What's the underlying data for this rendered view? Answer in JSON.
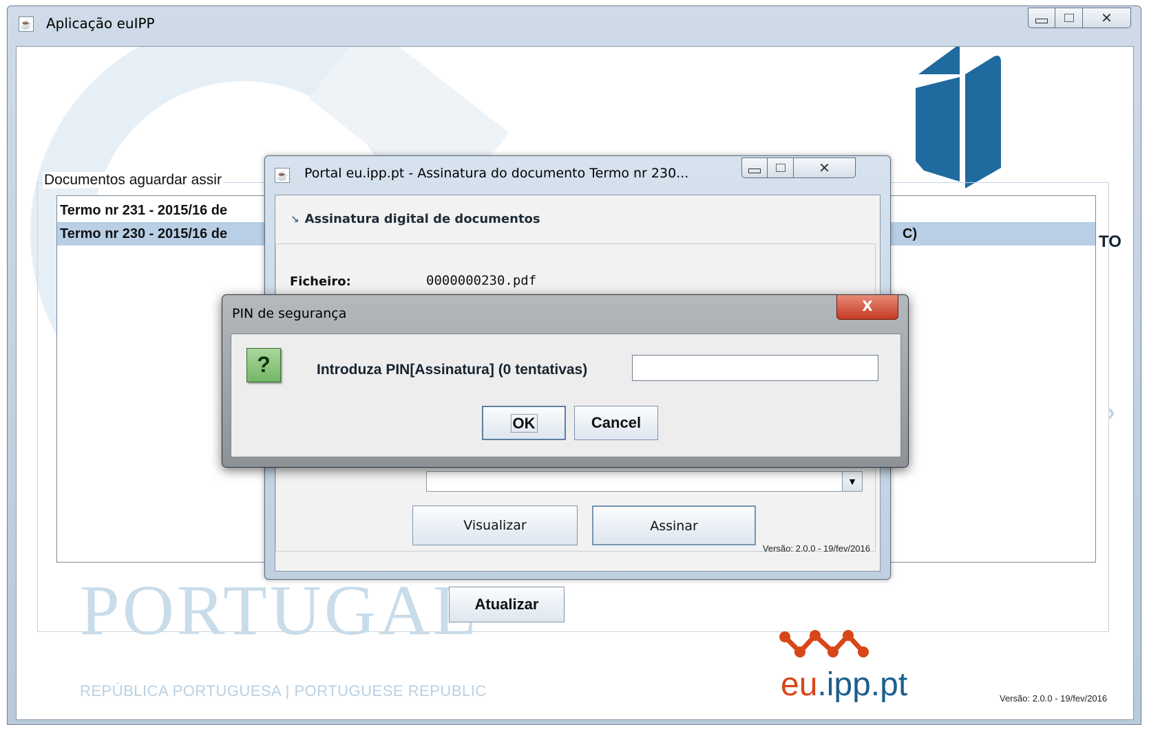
{
  "main_window": {
    "title": "Aplicação euIPP",
    "icon": "java-icon",
    "caption": {
      "minimize": "minimize-icon",
      "maximize": "maximize-icon",
      "close": "✕"
    }
  },
  "documents": {
    "group_title": "Documentos aguardar assir",
    "items": [
      {
        "label": "Termo nr 231 - 2015/16 de",
        "selected": false
      },
      {
        "label": "Termo nr 230 - 2015/16 de",
        "selected": true
      }
    ],
    "row_tail": "C)",
    "right_peek": "TO"
  },
  "footer": {
    "portugal": "PORTUGAL",
    "portugal_sub": "REPÚBLICA PORTUGUESA | PORTUGUESE REPUBLIC",
    "update_button": "Atualizar",
    "euipp_eu": "eu",
    "euipp_rest": ".ipp.pt",
    "version": "Versão: 2.0.0 - 19/fev/2016"
  },
  "sign_window": {
    "title": "Portal eu.ipp.pt - Assinatura do documento Termo nr 230...",
    "header_arrow": "↘",
    "header": "Assinatura digital de documentos",
    "file_label": "Ficheiro:",
    "file_value": "0000000230.pdf",
    "dropdown_arrow": "▼",
    "view_button": "Visualizar",
    "sign_button": "Assinar",
    "version": "Versão: 2.0.0 - 19/fev/2016"
  },
  "pin_dialog": {
    "title": "PIN de segurança",
    "close": "X",
    "question_mark": "?",
    "prompt": "Introduza PIN[Assinatura] (0 tentativas)",
    "pin_value": "",
    "ok_button": "OK",
    "cancel_button": "Cancel"
  },
  "colors": {
    "ipp_blue": "#1f6a9e",
    "eu_orange": "#d8461a",
    "selection": "#b8cfe6"
  }
}
